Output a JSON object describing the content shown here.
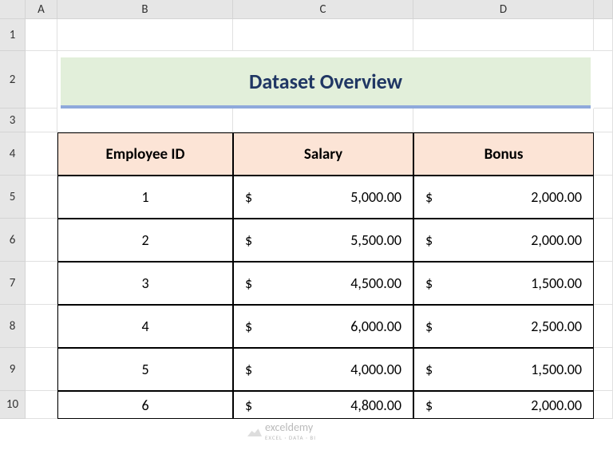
{
  "columns": [
    "",
    "A",
    "B",
    "C",
    "D",
    ""
  ],
  "rows": [
    "1",
    "2",
    "3",
    "4",
    "5",
    "6",
    "7",
    "8",
    "9",
    "10"
  ],
  "title": "Dataset Overview",
  "table": {
    "headers": [
      "Employee ID",
      "Salary",
      "Bonus"
    ],
    "data": [
      {
        "id": "1",
        "salary": "5,000.00",
        "bonus": "2,000.00"
      },
      {
        "id": "2",
        "salary": "5,500.00",
        "bonus": "2,000.00"
      },
      {
        "id": "3",
        "salary": "4,500.00",
        "bonus": "1,500.00"
      },
      {
        "id": "4",
        "salary": "6,000.00",
        "bonus": "2,500.00"
      },
      {
        "id": "5",
        "salary": "4,000.00",
        "bonus": "1,500.00"
      },
      {
        "id": "6",
        "salary": "4,800.00",
        "bonus": "2,000.00"
      }
    ]
  },
  "currency": "$",
  "watermark": {
    "text": "exceldemy",
    "sub": "EXCEL · DATA · BI"
  }
}
